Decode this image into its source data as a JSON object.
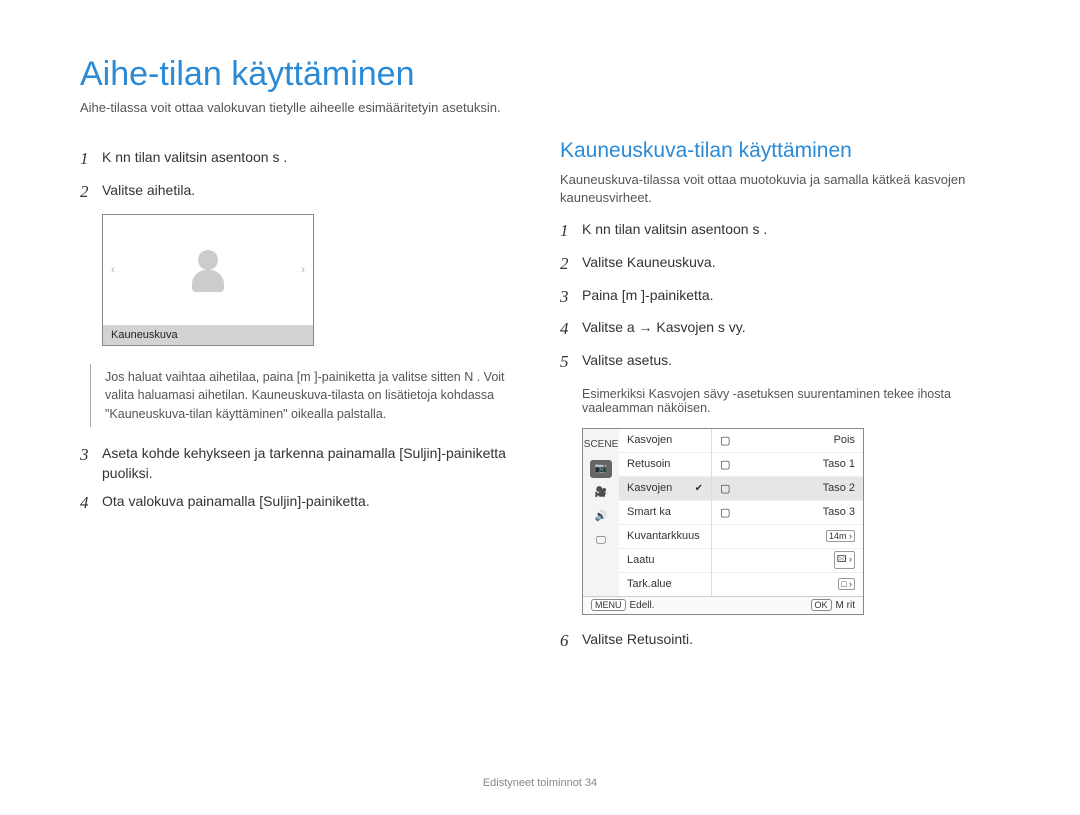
{
  "title": "Aihe-tilan käyttäminen",
  "intro": "Aihe-tilassa voit ottaa valokuvan tietylle aiheelle esimääritetyin asetuksin.",
  "left": {
    "steps": {
      "s1": "K  nn  tilan valitsin asentoon  s      .",
      "s2": "Valitse aihetila.",
      "s3": "Aseta kohde kehykseen ja tarkenna painamalla [Suljin]-painiketta puoliksi.",
      "s4": "Ota valokuva painamalla [Suljin]-painiketta."
    },
    "scene_label": "Kauneuskuva",
    "note": "Jos haluat vaihtaa aihetilaa, paina [m      ]-painiketta ja valitse sitten N     . Voit valita haluamasi aihetilan.\nKauneuskuva-tilasta on lisätietoja kohdassa \"Kauneuskuva-tilan käyttäminen\" oikealla palstalla."
  },
  "right": {
    "heading": "Kauneuskuva-tilan käyttäminen",
    "para": "Kauneuskuva-tilassa voit ottaa muotokuvia ja samalla kätkeä kasvojen kauneusvirheet.",
    "steps": {
      "s1": "K  nn  tilan valitsin asentoon  s      .",
      "s2": "Valitse Kauneuskuva.",
      "s3": "Paina [m      ]-painiketta.",
      "s4": "Valitse a     → Kasvojen s  vy.",
      "s5": "Valitse asetus.",
      "s5_sub": "Esimerkiksi Kasvojen sävy -asetuksen suurentaminen tekee ihosta vaaleamman näköisen.",
      "s6": "Valitse Retusointi."
    },
    "menu": {
      "left_items": [
        "Kasvojen",
        "Retusoin",
        "Kasvojen",
        "Smart ka",
        "Kuvantarkkuus",
        "Laatu",
        "Tark.alue"
      ],
      "right_items": [
        "Pois",
        "Taso 1",
        "Taso 2",
        "Taso 3"
      ],
      "right_badges": [
        "14m ›",
        "🖾 ›",
        "□ ›"
      ],
      "selected_left_index": 2,
      "selected_right_index": 2,
      "foot_left_pill": "MENU",
      "foot_left_text": "Edell.",
      "foot_right_pill": "OK",
      "foot_right_text": "M  rit"
    }
  },
  "footer": "Edistyneet toiminnot  34"
}
